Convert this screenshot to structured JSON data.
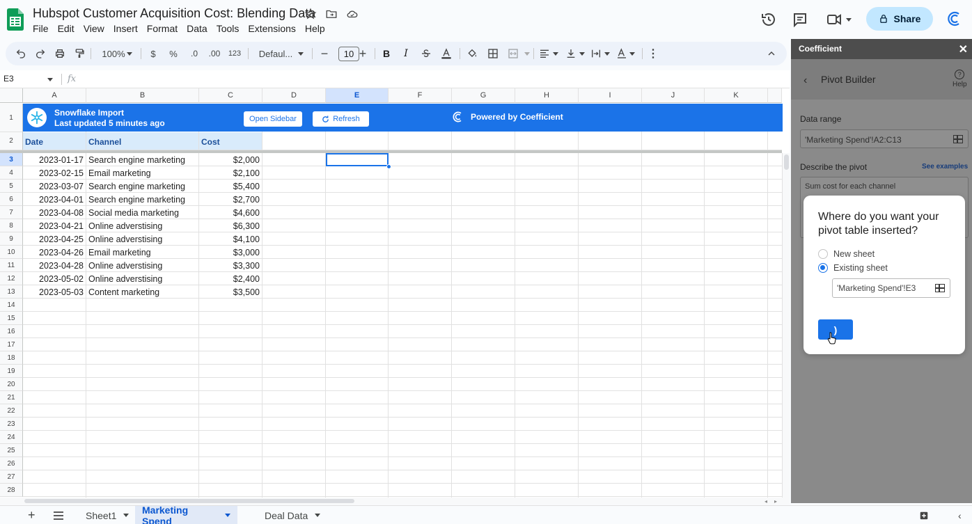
{
  "document": {
    "title": "Hubspot Customer Acquisition Cost: Blending Data",
    "menu": [
      "File",
      "Edit",
      "View",
      "Insert",
      "Format",
      "Data",
      "Tools",
      "Extensions",
      "Help"
    ],
    "share_label": "Share"
  },
  "toolbar": {
    "zoom": "100%",
    "currency": "$",
    "percent": "%",
    "dec_decrease": ".0",
    "dec_increase": ".00",
    "number_format": "123",
    "font": "Defaul...",
    "font_size": "10",
    "bold": "B",
    "italic": "I"
  },
  "formula_bar": {
    "cell_ref": "E3",
    "fx": "fx"
  },
  "grid": {
    "columns": [
      "A",
      "B",
      "C",
      "D",
      "E",
      "F",
      "G",
      "H",
      "I",
      "J",
      "K"
    ],
    "selected_column": "E",
    "rows": [
      "1",
      "2",
      "3",
      "4",
      "5",
      "6",
      "7",
      "8",
      "9",
      "10",
      "11",
      "12",
      "13",
      "14",
      "15",
      "16",
      "17",
      "18",
      "19",
      "20",
      "21",
      "22",
      "23",
      "24",
      "25",
      "26",
      "27",
      "28"
    ],
    "selected_row": "3"
  },
  "banner": {
    "title": "Snowflake Import",
    "subtitle": "Last updated 5 minutes ago",
    "open_sidebar": "Open Sidebar",
    "refresh": "Refresh",
    "powered_by": "Powered by Coefficient",
    "color": "#1b73e8"
  },
  "table": {
    "headers": [
      "Date",
      "Channel",
      "Cost"
    ],
    "rows": [
      [
        "2023-01-17",
        "Search engine marketing",
        "$2,000"
      ],
      [
        "2023-02-15",
        "Email marketing",
        "$2,100"
      ],
      [
        "2023-03-07",
        "Search engine marketing",
        "$5,400"
      ],
      [
        "2023-04-01",
        "Search engine marketing",
        "$2,700"
      ],
      [
        "2023-04-08",
        "Social media marketing",
        "$4,600"
      ],
      [
        "2023-04-21",
        "Online adverstising",
        "$6,300"
      ],
      [
        "2023-04-25",
        "Online adverstising",
        "$4,100"
      ],
      [
        "2023-04-26",
        "Email marketing",
        "$3,000"
      ],
      [
        "2023-04-28",
        "Online adverstising",
        "$3,300"
      ],
      [
        "2023-05-02",
        "Online adverstising",
        "$2,400"
      ],
      [
        "2023-05-03",
        "Content marketing",
        "$3,500"
      ]
    ]
  },
  "sheet_tabs": {
    "tabs": [
      "Sheet1",
      "Marketing Spend",
      "Deal Data"
    ],
    "active": "Marketing Spend"
  },
  "panel": {
    "app_name": "Coefficient",
    "title": "Pivot Builder",
    "help": "Help",
    "data_range_label": "Data range",
    "data_range_value": "'Marketing Spend'!A2:C13",
    "describe_label": "Describe the pivot",
    "see_examples": "See examples",
    "describe_value": "Sum cost for each channel"
  },
  "modal": {
    "title": "Where do you want your pivot table inserted?",
    "option_new": "New sheet",
    "option_existing": "Existing sheet",
    "selected_option": "Existing sheet",
    "location_value": "'Marketing Spend'!E3",
    "button_label": ")"
  }
}
